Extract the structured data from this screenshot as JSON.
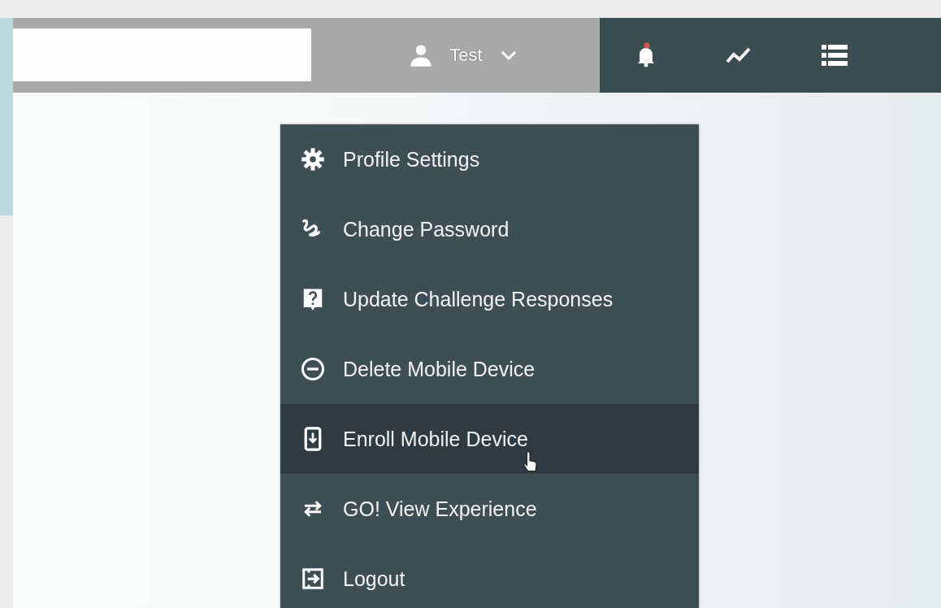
{
  "header": {
    "user": {
      "name": "Test"
    },
    "notifications": {
      "unread": true
    }
  },
  "user_menu": {
    "items": [
      {
        "label": "Profile Settings",
        "highlighted": false
      },
      {
        "label": "Change Password",
        "highlighted": false
      },
      {
        "label": "Update Challenge Responses",
        "highlighted": false
      },
      {
        "label": "Delete Mobile Device",
        "highlighted": false
      },
      {
        "label": "Enroll Mobile Device",
        "highlighted": true
      },
      {
        "label": "GO! View Experience",
        "highlighted": false
      },
      {
        "label": "Logout",
        "highlighted": false
      }
    ]
  }
}
